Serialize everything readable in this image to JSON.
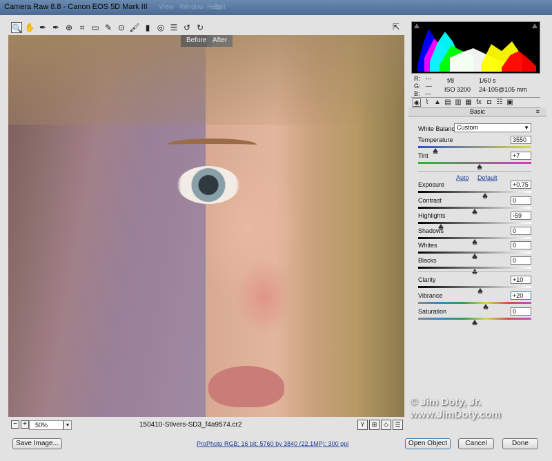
{
  "window": {
    "title": "Camera Raw 8.8  -  Canon EOS 5D Mark III",
    "ghost_menu": [
      "Help",
      "Window",
      "View",
      "Edit"
    ]
  },
  "toolbar": {
    "tools": [
      {
        "name": "zoom-tool-icon",
        "glyph": "🔍"
      },
      {
        "name": "hand-tool-icon",
        "glyph": "✋"
      },
      {
        "name": "white-balance-tool-icon",
        "glyph": "✒"
      },
      {
        "name": "color-sampler-tool-icon",
        "glyph": "✒"
      },
      {
        "name": "targeted-adjustment-tool-icon",
        "glyph": "⊕"
      },
      {
        "name": "crop-tool-icon",
        "glyph": "⌗"
      },
      {
        "name": "straighten-tool-icon",
        "glyph": "▭"
      },
      {
        "name": "spot-removal-tool-icon",
        "glyph": "✎"
      },
      {
        "name": "red-eye-tool-icon",
        "glyph": "⊙"
      },
      {
        "name": "adjustment-brush-icon",
        "glyph": "🖌"
      },
      {
        "name": "graduated-filter-icon",
        "glyph": "▮"
      },
      {
        "name": "radial-filter-icon",
        "glyph": "◎"
      },
      {
        "name": "preferences-icon",
        "glyph": "☰"
      },
      {
        "name": "rotate-left-icon",
        "glyph": "↺"
      },
      {
        "name": "rotate-right-icon",
        "glyph": "↻"
      }
    ],
    "fullscreen_glyph": "⇱"
  },
  "preview": {
    "before_label": "Before",
    "after_label": "After"
  },
  "status": {
    "zoom_minus": "−",
    "zoom_plus": "+",
    "zoom_level": "50%",
    "zoom_arrow": "▾",
    "filename": "150410-Stivers-SD3_f4a9574.cr2",
    "view_glyphs": [
      "Y",
      "⊞",
      "◇",
      "☰"
    ]
  },
  "bottom": {
    "save_label": "Save Image...",
    "workflow": "ProPhoto RGB; 16 bit; 5760 by 3840 (22.1MP); 300 ppi",
    "open_label": "Open Object",
    "cancel_label": "Cancel",
    "done_label": "Done"
  },
  "histogram": {
    "colors": [
      "#ff0000",
      "#ffff00",
      "#00ff00",
      "#00ffff",
      "#0000ff",
      "#ff00ff",
      "#ffffff"
    ]
  },
  "readout": {
    "r_label": "R:",
    "r_val": "---",
    "g_label": "G:",
    "g_val": "---",
    "b_label": "B:",
    "b_val": "---",
    "aperture": "f/8",
    "shutter": "1/60 s",
    "iso": "ISO 3200",
    "lens": "24-105@105 mm"
  },
  "tabs": [
    "◉",
    "⌇",
    "▲",
    "▤",
    "▥",
    "▦",
    "fx",
    "◘",
    "☷",
    "▣"
  ],
  "basic": {
    "header": "Basic",
    "menu_glyph": "≡",
    "wb_label": "White Balance:",
    "wb_value": "Custom",
    "wb_arrow": "▼",
    "auto_label": "Auto",
    "default_label": "Default",
    "sliders": [
      {
        "key": "temperature",
        "label": "Temperature",
        "value": "3550",
        "position": 0.15,
        "gradient": "linear-gradient(90deg,#2a4fc9,#e0d84a)"
      },
      {
        "key": "tint",
        "label": "Tint",
        "value": "+7",
        "position": 0.54,
        "gradient": "linear-gradient(90deg,#29b52f,#d53ac7)"
      },
      {
        "key": "exposure",
        "label": "Exposure",
        "value": "+0.75",
        "position": 0.59,
        "gradient": "linear-gradient(90deg,#000,#fff)"
      },
      {
        "key": "contrast",
        "label": "Contrast",
        "value": "0",
        "position": 0.5,
        "gradient": "linear-gradient(90deg,#000,#fff)"
      },
      {
        "key": "highlights",
        "label": "Highlights",
        "value": "-59",
        "position": 0.2,
        "gradient": "linear-gradient(90deg,#000,#fff)"
      },
      {
        "key": "shadows",
        "label": "Shadows",
        "value": "0",
        "position": 0.5,
        "gradient": "linear-gradient(90deg,#000,#fff)"
      },
      {
        "key": "whites",
        "label": "Whites",
        "value": "0",
        "position": 0.5,
        "gradient": "linear-gradient(90deg,#000,#fff)"
      },
      {
        "key": "blacks",
        "label": "Blacks",
        "value": "0",
        "position": 0.5,
        "gradient": "linear-gradient(90deg,#000,#fff)"
      },
      {
        "key": "clarity",
        "label": "Clarity",
        "value": "+10",
        "position": 0.55,
        "gradient": "linear-gradient(90deg,#000,#fff)"
      },
      {
        "key": "vibrance",
        "label": "Vibrance",
        "value": "+20",
        "position": 0.6,
        "gradient": "linear-gradient(90deg,#888,#2a8ad0,#2aa052,#d8d84a,#d84a4a,#c84ad0)"
      },
      {
        "key": "saturation",
        "label": "Saturation",
        "value": "0",
        "position": 0.5,
        "gradient": "linear-gradient(90deg,#888,#2a8ad0,#2aa052,#d8d84a,#d84a4a,#c84ad0)"
      }
    ]
  },
  "watermark": {
    "line1": "© Jim Doty, Jr.",
    "line2": "www.JimDoty.com"
  }
}
